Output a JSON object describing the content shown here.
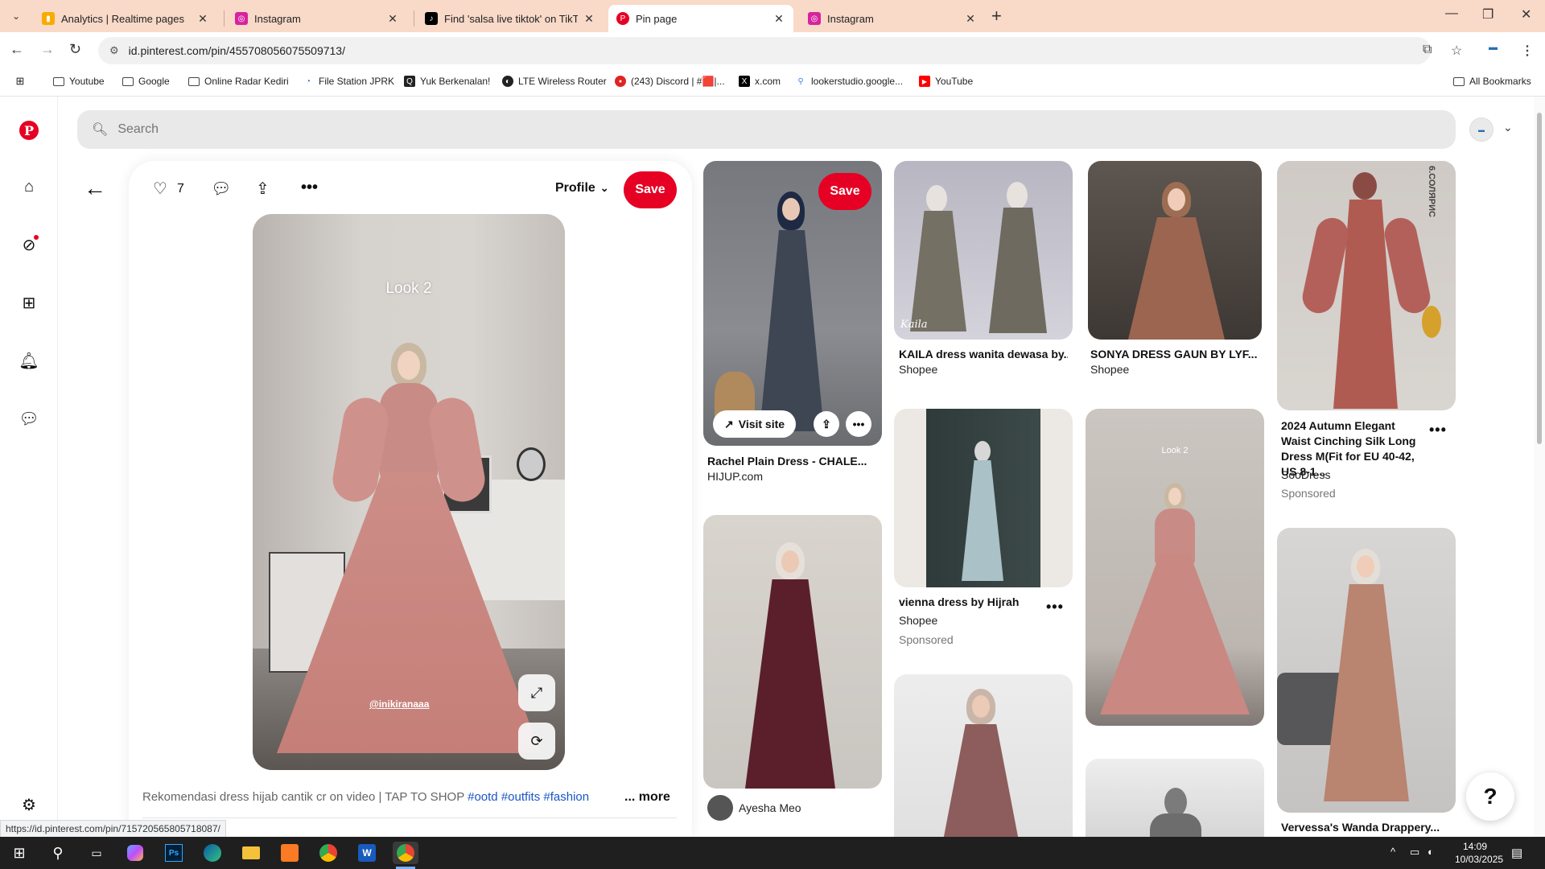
{
  "browser": {
    "tabs": [
      {
        "label": "Analytics | Realtime pages",
        "icon": "analytics-icon",
        "color": "#f9ab00"
      },
      {
        "label": "Instagram",
        "icon": "instagram-icon",
        "color": "#d6249f"
      },
      {
        "label": "Find 'salsa live tiktok' on TikTok",
        "icon": "tiktok-icon",
        "color": "#000000"
      },
      {
        "label": "Pin page",
        "icon": "pinterest-icon",
        "color": "#e60023"
      },
      {
        "label": "Instagram",
        "icon": "instagram-icon",
        "color": "#d6249f"
      }
    ],
    "active_tab": 3,
    "url": "id.pinterest.com/pin/455708056075509713/",
    "bookmarks": [
      {
        "label": "Youtube",
        "icon": "folder-icon"
      },
      {
        "label": "Google",
        "icon": "folder-icon"
      },
      {
        "label": "Online Radar Kediri",
        "icon": "folder-icon"
      },
      {
        "label": "File Station JPRK",
        "icon": "file-station-icon"
      },
      {
        "label": "Yuk Berkenalan!",
        "icon": "q-icon"
      },
      {
        "label": "LTE Wireless Router",
        "icon": "router-icon"
      },
      {
        "label": "(243) Discord | #🟥|...",
        "icon": "discord-icon"
      },
      {
        "label": "x.com",
        "icon": "x-icon"
      },
      {
        "label": "lookerstudio.google...",
        "icon": "looker-icon"
      },
      {
        "label": "YouTube",
        "icon": "youtube-icon"
      }
    ],
    "all_bookmarks": "All Bookmarks",
    "status_url": "https://id.pinterest.com/pin/715720565805718087/"
  },
  "search": {
    "placeholder": "Search"
  },
  "pin": {
    "likes": "7",
    "profile_label": "Profile",
    "save_label": "Save",
    "overlay_text": "Look 2",
    "watermark": "@inikiranaaa",
    "description": "Rekomendasi dress hijab cantik cr on video | TAP TO SHOP",
    "hashtags": [
      "#ootd",
      "#outfits",
      "#fashion"
    ],
    "more_label": "... more"
  },
  "grid": {
    "save_label": "Save",
    "visit_site_label": "Visit site",
    "items": [
      {
        "title": "Rachel Plain Dress - CHALE...",
        "source": "HIJUP.com"
      },
      {
        "title": "",
        "source": "Ayesha Meo"
      },
      {
        "title": "KAILA dress wanita dewasa by...",
        "source": "Shopee"
      },
      {
        "title": "vienna dress by Hijrah",
        "source": "Shopee",
        "sponsored": "Sponsored"
      },
      {
        "title": "SONYA DRESS GAUN BY LYF...",
        "source": "Shopee"
      },
      {
        "title": "",
        "overlay": "Look 2"
      },
      {
        "title": "2024 Autumn Elegant Waist Cinching Silk Long Dress M(Fit for EU 40-42, US 8-1...",
        "source": "SooDress",
        "sponsored": "Sponsored"
      },
      {
        "title": "Vervessa's Wanda Drappery...",
        "source": ""
      }
    ],
    "kaila_brand": "Kaila",
    "vertical_brand": "6.СОЛЯРИС"
  },
  "help_label": "?",
  "taskbar": {
    "time": "14:09",
    "date": "10/03/2025"
  },
  "colors": {
    "pinterest_red": "#e60023",
    "tab_bar": "#f9d9c8"
  }
}
